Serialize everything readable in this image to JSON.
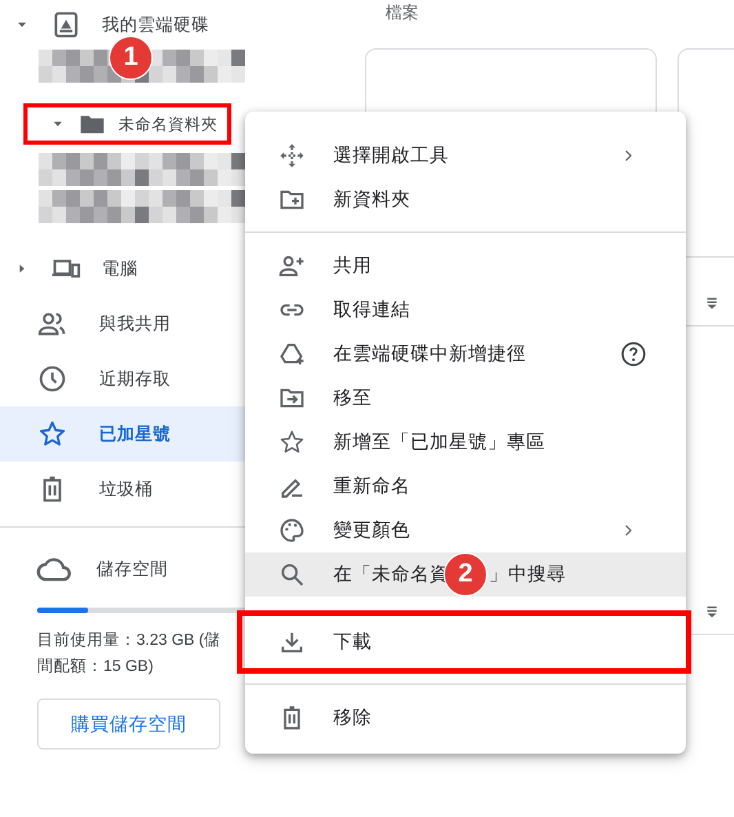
{
  "sidebar": {
    "tree": [
      {
        "label": "我的雲端硬碟",
        "expanded": true,
        "children": [
          {
            "kind": "redacted"
          },
          {
            "kind": "folder",
            "label": "未命名資料夾",
            "expanded": true,
            "highlighted": true,
            "callout": "1",
            "children": [
              {
                "kind": "redacted"
              },
              {
                "kind": "redacted"
              }
            ]
          }
        ]
      },
      {
        "label": "電腦",
        "expanded": false
      }
    ],
    "items": [
      {
        "label": "與我共用",
        "selected": false
      },
      {
        "label": "近期存取",
        "selected": false
      },
      {
        "label": "已加星號",
        "selected": true
      },
      {
        "label": "垃圾桶",
        "selected": false
      }
    ],
    "storage": {
      "label": "儲存空間",
      "level": 0.2,
      "usage_lines": [
        "目前使用量：3.23 GB (儲",
        "間配額：15 GB)"
      ],
      "button": "購買儲存空間"
    }
  },
  "main": {
    "heading": "檔案"
  },
  "context_menu": {
    "groups": [
      [
        {
          "label": "選擇開啟工具",
          "has_submenu": true
        },
        {
          "label": "新資料夾"
        }
      ],
      [
        {
          "label": "共用"
        },
        {
          "label": "取得連結"
        },
        {
          "label": "在雲端硬碟中新增捷徑",
          "has_help": true
        },
        {
          "label": "移至"
        },
        {
          "label": "新增至「已加星號」專區"
        },
        {
          "label": "重新命名"
        },
        {
          "label": "變更顏色",
          "has_submenu": true
        },
        {
          "label_parts": [
            "在「未命名資",
            "」中搜尋"
          ],
          "callout": "2",
          "hovered": true
        },
        {
          "label": "下載",
          "highlighted": true
        }
      ],
      [
        {
          "label": "移除"
        }
      ]
    ]
  }
}
